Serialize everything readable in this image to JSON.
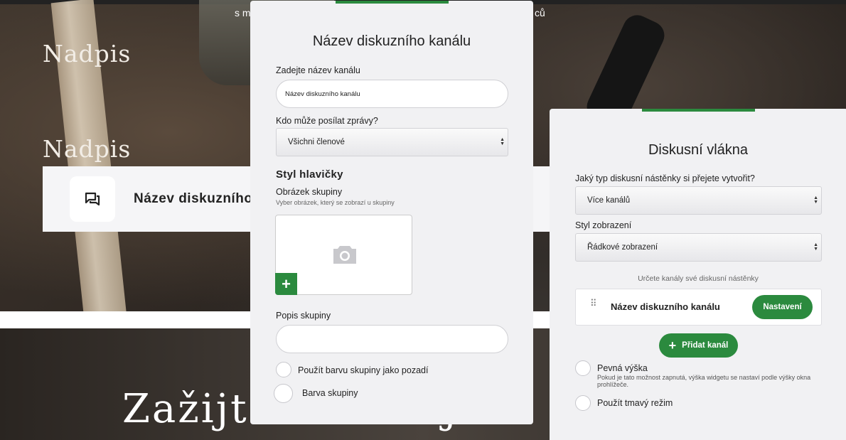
{
  "background": {
    "heading_1": "Nadpis",
    "heading_2": "Nadpis",
    "top_text_left": "s m",
    "top_text_right": "ců",
    "channel_preview_name": "Název diskuzního ka",
    "hero_text_left": "Zažijte",
    "hero_text_right": "j",
    "icons": {
      "channel": "forum-icon",
      "chat": "chat-bubble-icon"
    }
  },
  "channel_panel": {
    "title": "Název diskuzního kanálu",
    "name_label": "Zadejte název kanálu",
    "name_value": "Název diskuzního kanálu",
    "who_label": "Kdo může posílat zprávy?",
    "who_selected": "Všichni členové",
    "header_style_heading": "Styl hlavičky",
    "group_image_label": "Obrázek skupiny",
    "group_image_hint": "Vyber obrázek, který se zobrazí u skupiny",
    "upload_icon": "camera-icon",
    "add_image_glyph": "+",
    "description_label": "Popis skupiny",
    "description_value": "",
    "use_color_bg_label": "Použít barvu skupiny jako pozadí",
    "group_color_label": "Barva skupiny"
  },
  "threads_panel": {
    "title": "Diskusní vlákna",
    "type_label": "Jaký typ diskusní nástěnky si přejete vytvořit?",
    "type_selected": "Více kanálů",
    "display_label": "Styl zobrazení",
    "display_selected": "Řádkové zobrazení",
    "channels_hint": "Určete kanály své diskusní nástěnky",
    "channel_name": "Název diskuzního kanálu",
    "settings_button": "Nastavení",
    "add_channel_button": "Přidat kanál",
    "add_glyph": "+",
    "drag_glyph": "⠿",
    "fixed_height_label": "Pevná výška",
    "fixed_height_note": "Pokud je tato možnost zapnutá, výška widgetu se nastaví podle výšky okna prohlížeče.",
    "dark_mode_label": "Použít tmavý režim"
  },
  "colors": {
    "accent": "#2b8a3e",
    "panel_bg": "#f1f1f3"
  }
}
